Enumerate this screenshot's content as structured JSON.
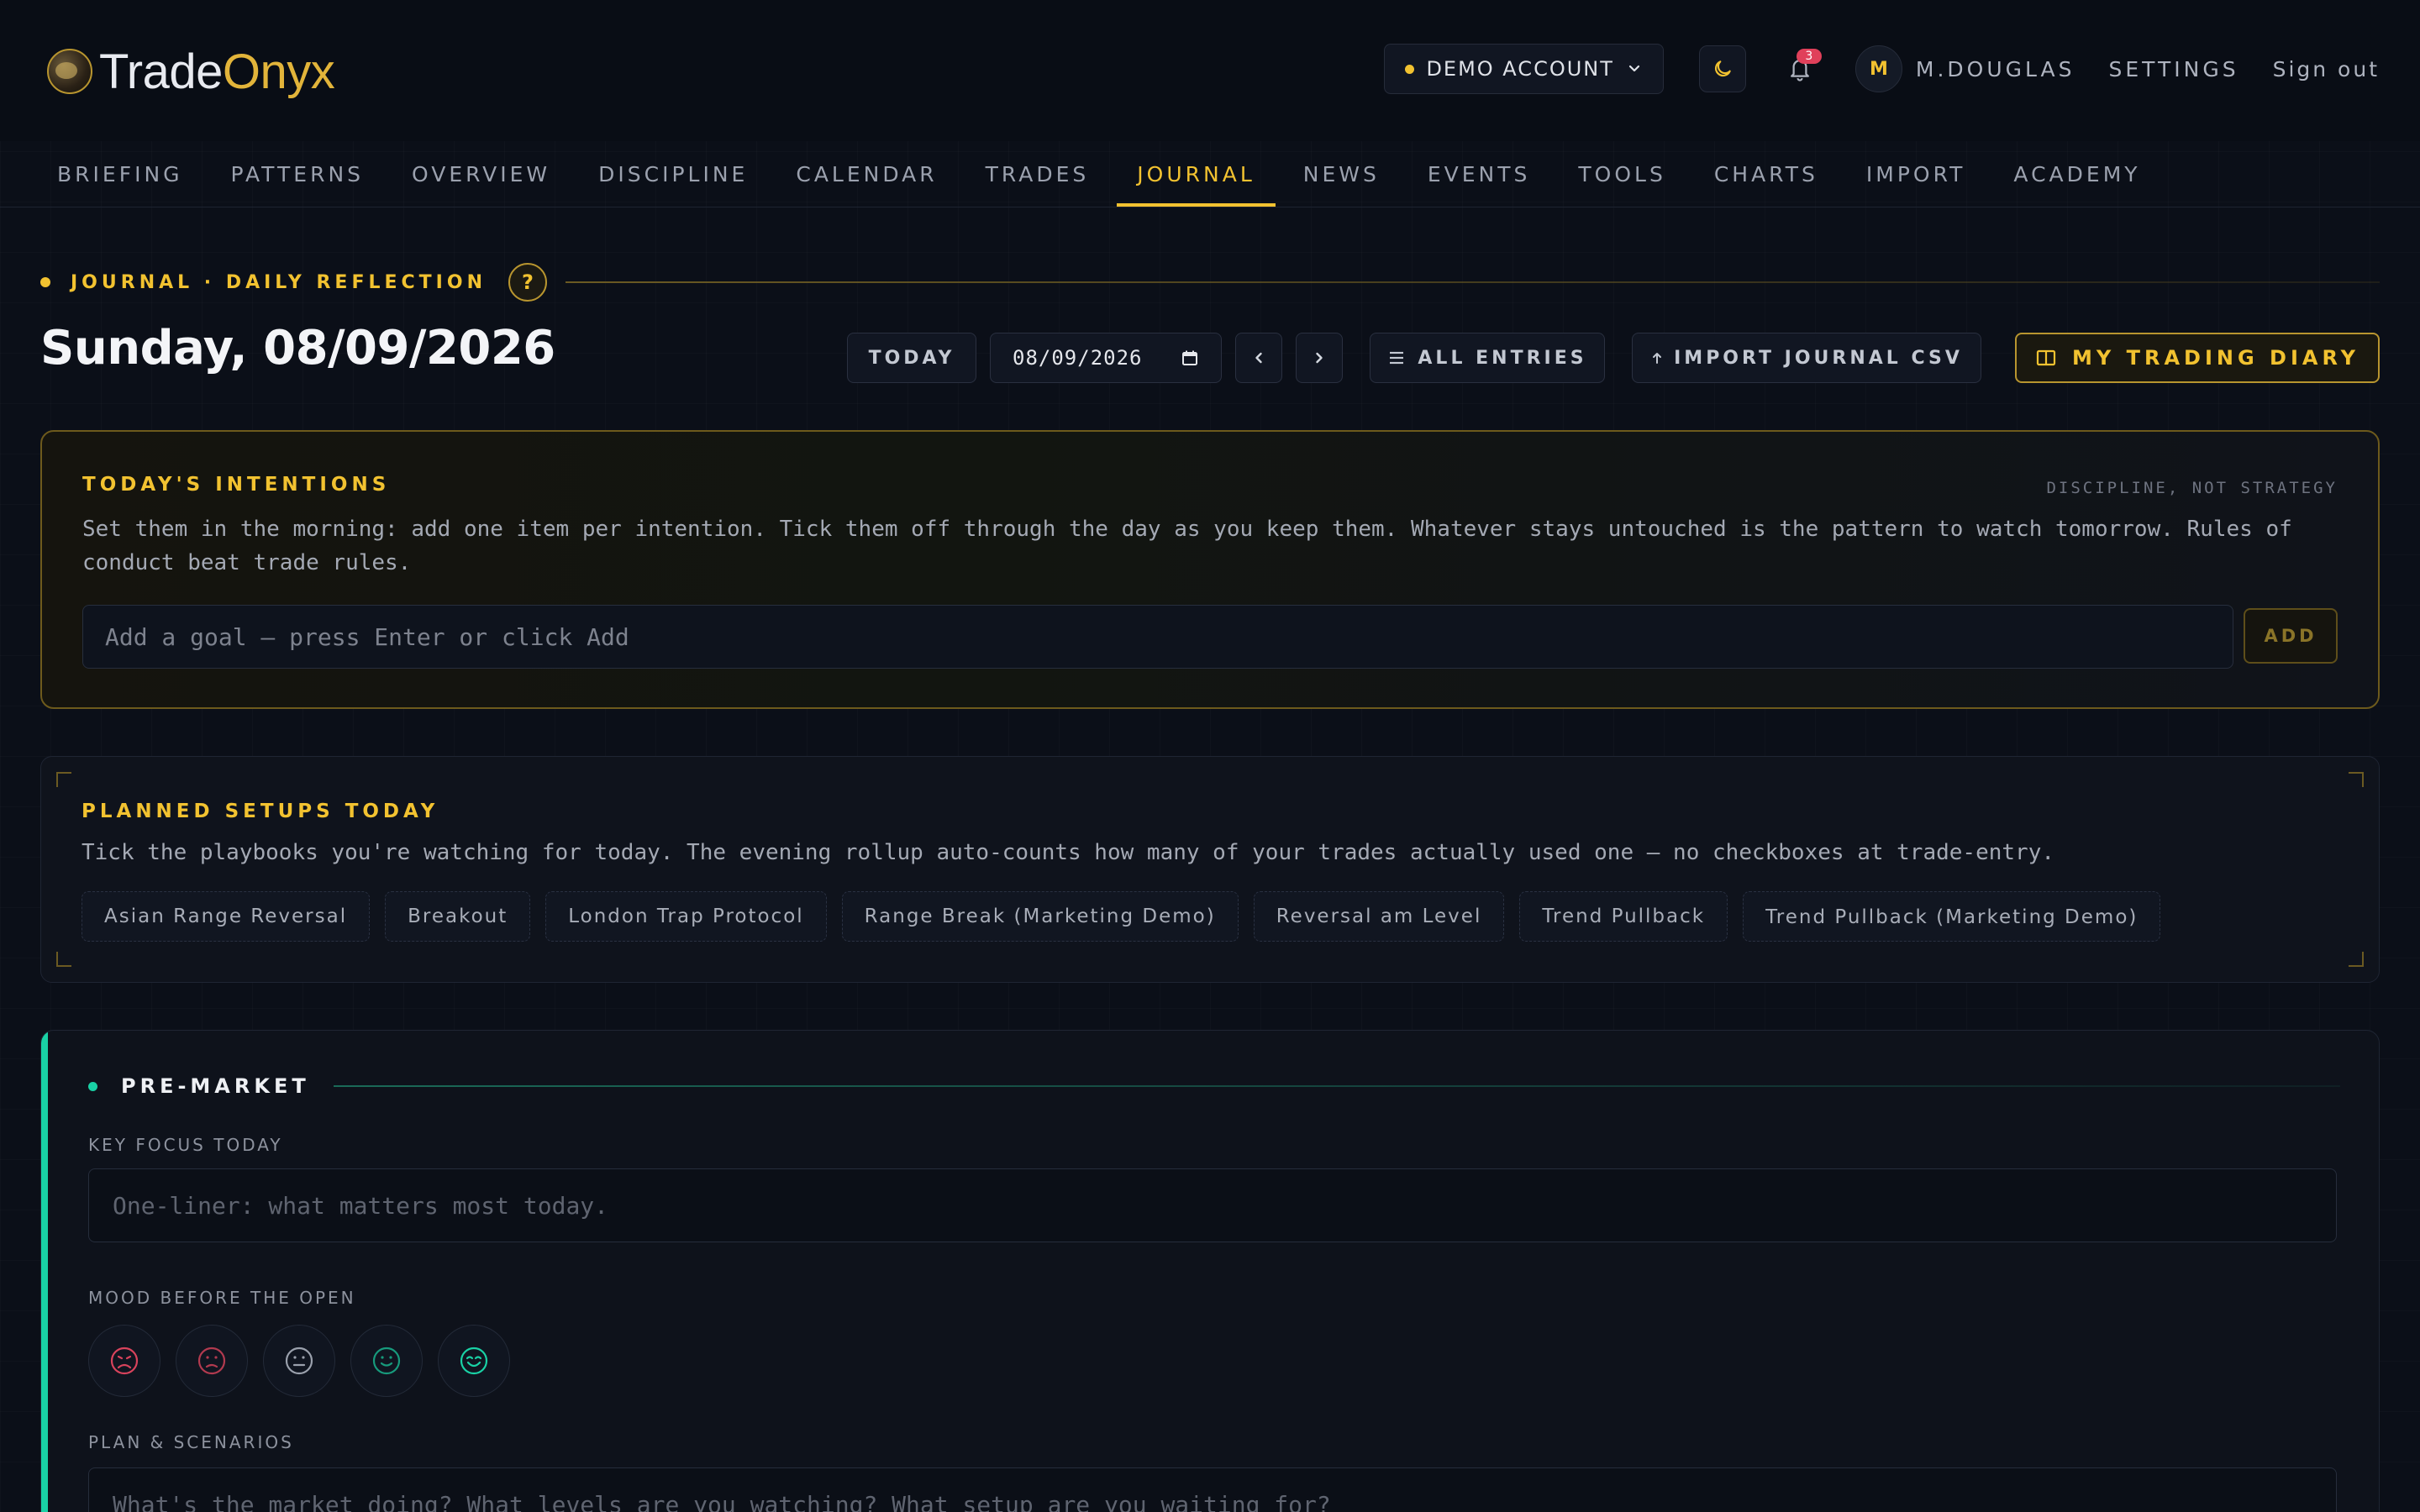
{
  "header": {
    "logo_part1": "Trade",
    "logo_part2": "Onyx",
    "account_label": "DEMO ACCOUNT",
    "notification_count": "3",
    "avatar_initial": "M",
    "username": "M.DOUGLAS",
    "settings_label": "SETTINGS",
    "signout_label": "Sign out"
  },
  "nav": {
    "tabs": [
      "BRIEFING",
      "PATTERNS",
      "OVERVIEW",
      "DISCIPLINE",
      "CALENDAR",
      "TRADES",
      "JOURNAL",
      "NEWS",
      "EVENTS",
      "TOOLS",
      "CHARTS",
      "IMPORT",
      "ACADEMY"
    ],
    "active": "JOURNAL"
  },
  "journal": {
    "section_label": "JOURNAL · DAILY REFLECTION",
    "help_label": "?",
    "date_title": "Sunday, 08/09/2026",
    "today_label": "TODAY",
    "date_value": "08/09/2026",
    "all_entries_label": "ALL ENTRIES",
    "import_label": "IMPORT JOURNAL CSV",
    "diary_label": "MY TRADING DIARY"
  },
  "intentions": {
    "title": "TODAY'S INTENTIONS",
    "tag": "DISCIPLINE, NOT STRATEGY",
    "description": "Set them in the morning: add one item per intention. Tick them off through the day as you keep them. Whatever stays untouched is the pattern to watch tomorrow. Rules of conduct beat trade rules.",
    "input_placeholder": "Add a goal — press Enter or click Add",
    "add_label": "ADD"
  },
  "setups": {
    "title": "PLANNED SETUPS TODAY",
    "description": "Tick the playbooks you're watching for today. The evening rollup auto-counts how many of your trades actually used one — no checkboxes at trade-entry.",
    "items": [
      "Asian Range Reversal",
      "Breakout",
      "London Trap Protocol",
      "Range Break (Marketing Demo)",
      "Reversal am Level",
      "Trend Pullback",
      "Trend Pullback (Marketing Demo)"
    ]
  },
  "premarket": {
    "title": "PRE-MARKET",
    "focus_label": "KEY FOCUS TODAY",
    "focus_placeholder": "One-liner: what matters most today.",
    "mood_label": "MOOD BEFORE THE OPEN",
    "moods": [
      "very-bad-face-icon",
      "bad-face-icon",
      "neutral-face-icon",
      "good-face-icon",
      "very-good-face-icon"
    ],
    "plan_label": "PLAN & SCENARIOS",
    "plan_placeholder": "What's the market doing? What levels are you watching? What setup are you waiting for?"
  },
  "colors": {
    "accent": "#f2c230",
    "teal": "#19d1a5",
    "background": "#0b0f18",
    "badge": "#e0405a"
  }
}
